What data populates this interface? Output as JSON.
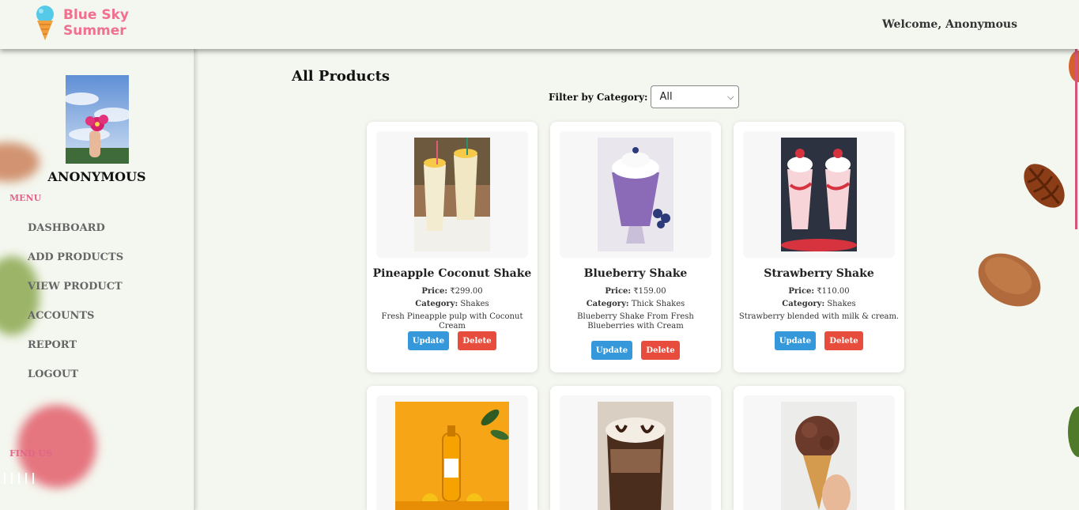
{
  "header": {
    "logo_line1": "Blue Sky",
    "logo_line2": "Summer",
    "welcome": "Welcome, Anonymous"
  },
  "sidebar": {
    "user_name": "ANONYMOUS",
    "menu_label": "MENU",
    "items": [
      {
        "label": "DASHBOARD"
      },
      {
        "label": "ADD PRODUCTS"
      },
      {
        "label": "VIEW PRODUCT"
      },
      {
        "label": "ACCOUNTS"
      },
      {
        "label": "REPORT"
      },
      {
        "label": "LOGOUT"
      }
    ],
    "find_label": "FIND US"
  },
  "main": {
    "title": "All Products",
    "filter_label": "Filter by Category:",
    "filter_value": "All",
    "price_label": "Price:",
    "category_label": "Category:",
    "update_label": "Update",
    "delete_label": "Delete",
    "products": [
      {
        "name": "Pineapple Coconut Shake",
        "price": "₹299.00",
        "category": "Shakes",
        "description": "Fresh Pineapple pulp with Coconut Cream"
      },
      {
        "name": "Blueberry Shake",
        "price": "₹159.00",
        "category": "Thick Shakes",
        "description": "Blueberry Shake From Fresh Blueberries with Cream"
      },
      {
        "name": "Strawberry Shake",
        "price": "₹110.00",
        "category": "Shakes",
        "description": "Strawberry blended with milk & cream."
      },
      {
        "name": "",
        "price": "",
        "category": "",
        "description": ""
      },
      {
        "name": "",
        "price": "",
        "category": "",
        "description": ""
      },
      {
        "name": "",
        "price": "",
        "category": "",
        "description": ""
      }
    ]
  },
  "colors": {
    "accent_pink": "#f0708f",
    "update_blue": "#3498db",
    "delete_red": "#e74c3c",
    "background": "#f4f7ef"
  }
}
